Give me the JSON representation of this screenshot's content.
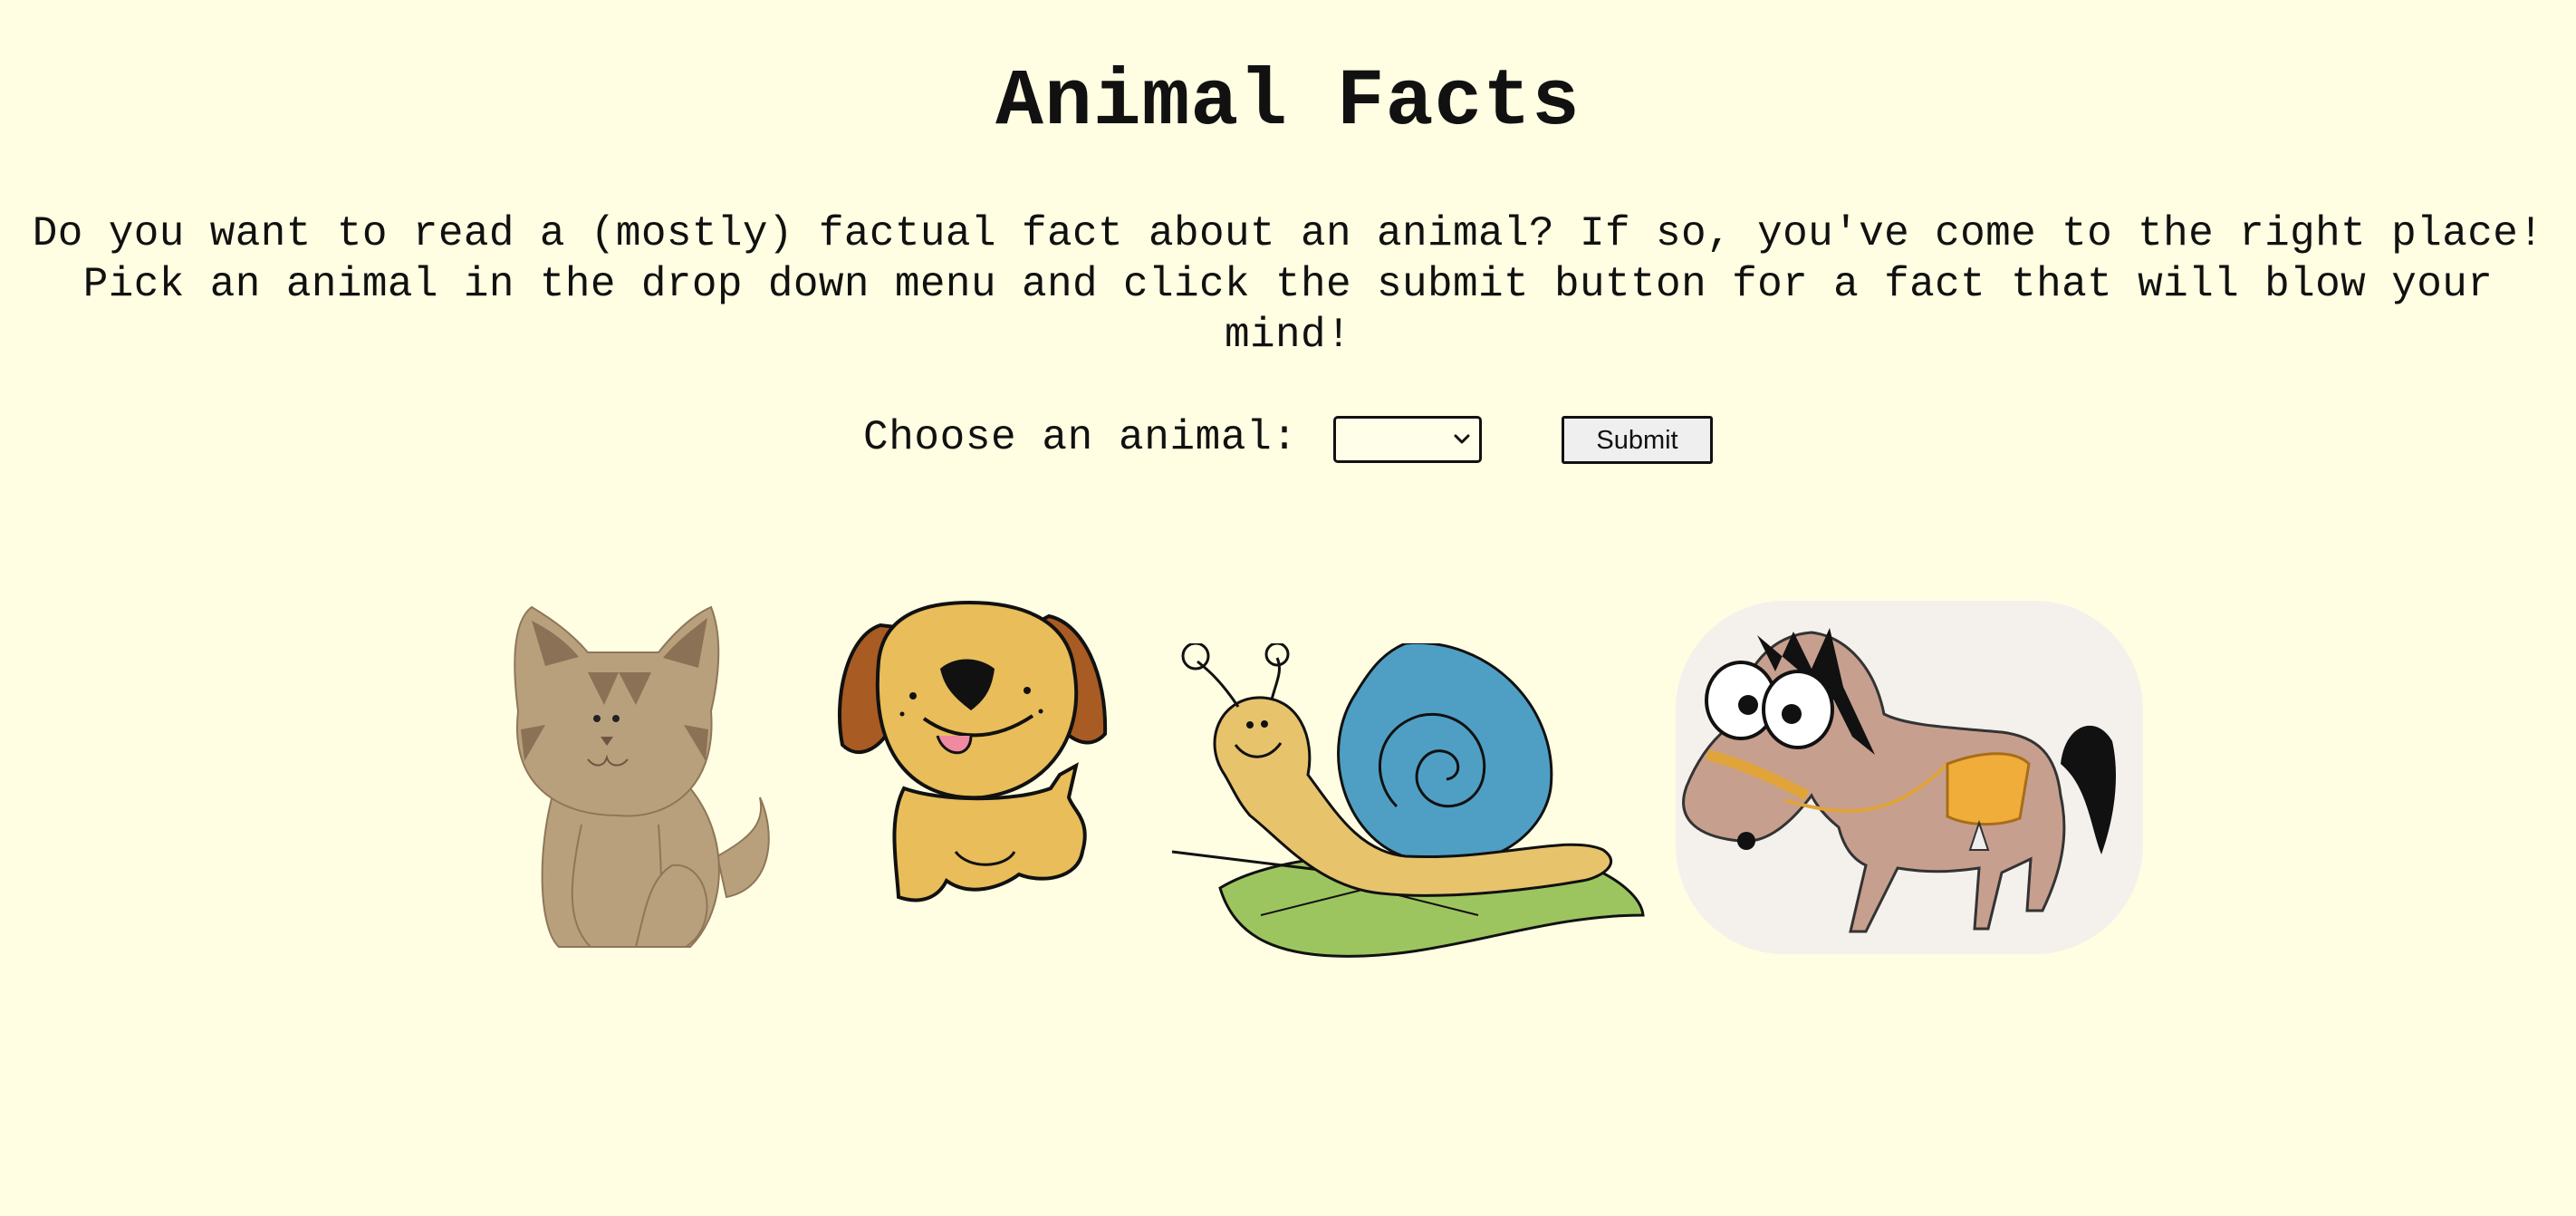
{
  "page": {
    "title": "Animal Facts",
    "intro": "Do you want to read a (mostly) factual fact about an animal? If so, you've come to the right place! Pick an animal in the drop down menu and click the submit button for a fact that will blow your mind!"
  },
  "form": {
    "label": "Choose an animal:",
    "selected_value": "",
    "submit_label": "Submit"
  },
  "images": [
    {
      "icon": "cat-icon"
    },
    {
      "icon": "dog-icon"
    },
    {
      "icon": "snail-icon"
    },
    {
      "icon": "horse-icon"
    }
  ],
  "colors": {
    "background": "#fffee2",
    "button_background": "#efefef",
    "cat": "#b9a07c",
    "dog": "#e8bd5a",
    "snail_shell": "#4f9fc4",
    "horse": "#c79f8f"
  }
}
